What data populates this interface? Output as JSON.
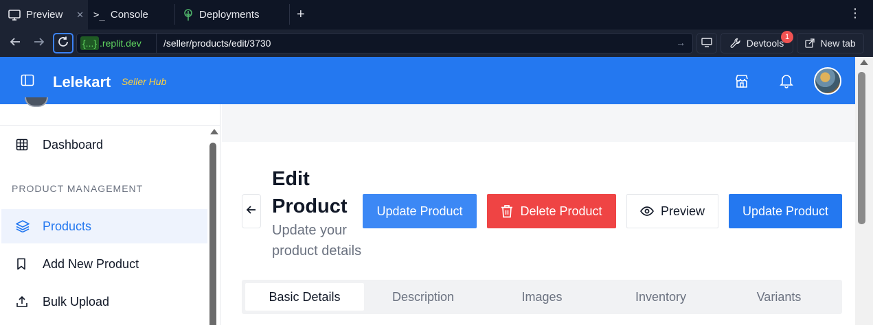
{
  "browser": {
    "tabs": [
      {
        "label": "Preview",
        "icon": "monitor-icon",
        "active": true
      },
      {
        "label": "Console",
        "icon": "terminal-icon",
        "active": false
      },
      {
        "label": "Deployments",
        "icon": "deploy-icon",
        "active": false
      }
    ],
    "close_glyph": "✕",
    "new_tab_glyph": "+",
    "menu_glyph": "⋮",
    "url_origin_brace": "{...}",
    "url_origin_domain": ".replit.dev",
    "url_path": "/seller/products/edit/3730",
    "devtools_label": "Devtools",
    "devtools_badge": "1",
    "newtab_label": "New tab"
  },
  "app": {
    "brand": "Lelekart",
    "brand_sub": "Seller Hub",
    "accent": "#2478f0",
    "danger": "#ef4444"
  },
  "sidebar": {
    "dashboard": "Dashboard",
    "section_title": "PRODUCT MANAGEMENT",
    "items": [
      {
        "label": "Products",
        "icon": "layers-icon",
        "active": true
      },
      {
        "label": "Add New Product",
        "icon": "bookmark-icon",
        "active": false
      },
      {
        "label": "Bulk Upload",
        "icon": "upload-icon",
        "active": false
      }
    ]
  },
  "main": {
    "title": "Edit Product",
    "subtitle": "Update your product details",
    "buttons": {
      "update_primary": "Update Product",
      "delete": "Delete Product",
      "preview": "Preview",
      "update_secondary": "Update Product"
    },
    "tabs": [
      "Basic Details",
      "Description",
      "Images",
      "Inventory",
      "Variants"
    ],
    "active_tab": "Basic Details"
  }
}
